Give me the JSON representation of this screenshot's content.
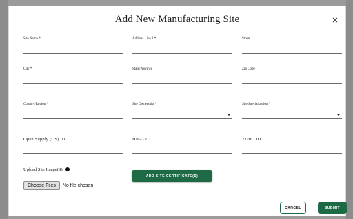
{
  "modal": {
    "title": "Add New Manufacturing Site",
    "close_icon": "close-icon",
    "close_glyph": "×"
  },
  "fields": {
    "site_name": {
      "label": "Site Name *"
    },
    "address_line1": {
      "label": "Address Line 1 *"
    },
    "street": {
      "label": "Street"
    },
    "city": {
      "label": "City *"
    },
    "state_province": {
      "label": "State/Province"
    },
    "zip_code": {
      "label": "Zip Code"
    },
    "country_region": {
      "label": "Country/Region *"
    },
    "site_ownership": {
      "label": "Site Ownership *"
    },
    "site_specialization": {
      "label": "Site Specialization *"
    },
    "open_supply_id": {
      "label": "Open Supply (OS) ID"
    },
    "higg_id": {
      "label": "HIGG ID"
    },
    "zdhc_id": {
      "label": "ZDHC ID"
    }
  },
  "upload": {
    "label": "Upload Site Image(S)",
    "choose_button": "Choose Files",
    "status": "No file chosen"
  },
  "buttons": {
    "add_certificate": "ADD SITE CERTIFICATE(S)",
    "cancel": "CANCEL",
    "submit": "SUBMIT"
  },
  "colors": {
    "accent": "#1d6a45",
    "backdrop": "#9b9b9b"
  }
}
